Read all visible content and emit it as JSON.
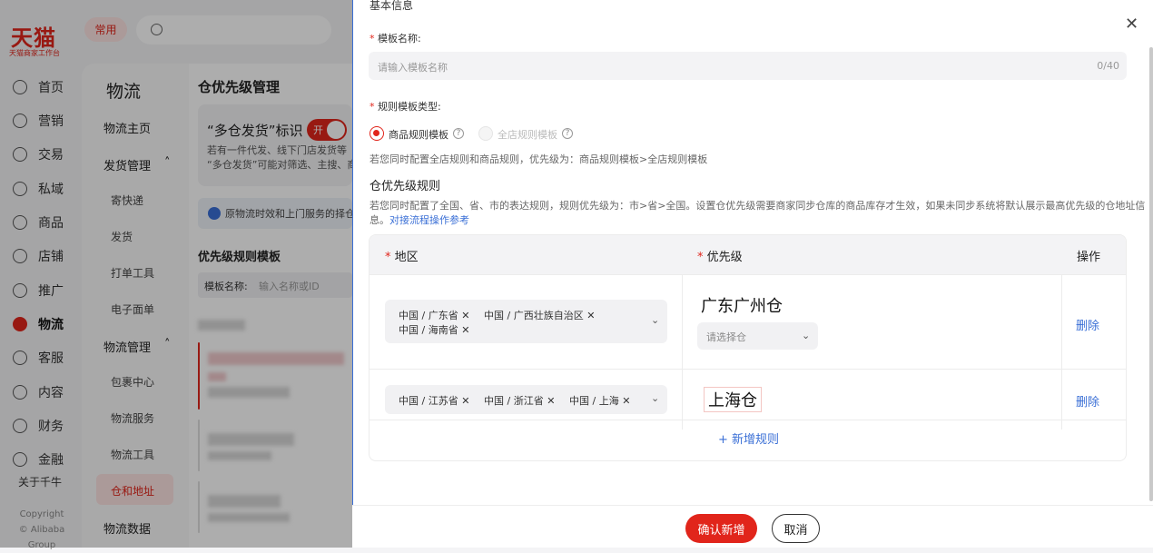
{
  "app": {
    "logo": "天猫",
    "logo_sub": "天猫商家工作台",
    "top_button": "常用"
  },
  "nav": {
    "items": [
      {
        "label": "首页",
        "icon": "home-icon"
      },
      {
        "label": "营销",
        "icon": "megaphone-icon"
      },
      {
        "label": "交易",
        "icon": "trade-icon"
      },
      {
        "label": "私域",
        "icon": "users-icon"
      },
      {
        "label": "商品",
        "icon": "goods-icon"
      },
      {
        "label": "店铺",
        "icon": "store-icon"
      },
      {
        "label": "推广",
        "icon": "bulb-icon"
      },
      {
        "label": "物流",
        "icon": "logistics-icon"
      },
      {
        "label": "客服",
        "icon": "headset-icon"
      },
      {
        "label": "内容",
        "icon": "content-icon"
      },
      {
        "label": "财务",
        "icon": "yen-icon"
      },
      {
        "label": "金融",
        "icon": "finance-icon"
      }
    ],
    "active_index": 7,
    "about": "关于千牛",
    "copyright_1": "Copyright",
    "copyright_2": "© Alibaba Group"
  },
  "subnav": {
    "title": "物流",
    "items": [
      "物流主页",
      "发货管理",
      "寄快递",
      "发货",
      "打单工具",
      "电子面单",
      "物流管理",
      "包裹中心",
      "物流服务",
      "物流工具",
      "仓和地址",
      "物流数据"
    ],
    "group_1_caret": "˄",
    "group_2_caret": "˄"
  },
  "main": {
    "title": "仓优先级管理",
    "card_title": "“多仓发货”标识",
    "toggle_label": "开",
    "card_desc_1": "若有一件代发、线下门店发货等",
    "card_desc_2": "“多仓发货”可能对筛选、主搜、商",
    "info": "原物流时效和上门服务的择仓",
    "section": "优先级规则模板",
    "filter_label": "模板名称:",
    "filter_placeholder": "输入名称或ID"
  },
  "drawer": {
    "section_basic": "基本信息",
    "name_label": "模板名称:",
    "name_placeholder": "请输入模板名称",
    "name_count": "0/40",
    "type_label": "规则模板类型:",
    "type_option_1": "商品规则模板",
    "type_option_2": "全店规则模板",
    "type_note": "若您同时配置全店规则和商品规则，优先级为：商品规则模板>全店规则模板",
    "priority_title": "仓优先级规则",
    "priority_note_1": "若您同时配置了全国、省、市的表达规则，规则优先级为：市>省>全国。设置仓优先级需要商家同步仓库的商品库存才生效，如果未同步系统将默认展示最高优先级的仓地址信",
    "priority_note_2": "息。",
    "priority_link": "对接流程操作参考",
    "table": {
      "col_region": "地区",
      "col_priority": "优先级",
      "col_action": "操作",
      "rows": [
        {
          "tags": [
            "中国 / 广东省",
            "中国 / 广西壮族自治区",
            "中国 / 海南省"
          ],
          "warehouse": "广东广州仓",
          "select_placeholder": "请选择仓",
          "action": "删除"
        },
        {
          "tags": [
            "中国 / 江苏省",
            "中国 / 浙江省",
            "中国 / 上海"
          ],
          "warehouse": "上海仓",
          "action": "删除"
        }
      ],
      "add_rule": "+ 新增规则"
    },
    "confirm": "确认新增",
    "cancel": "取消"
  }
}
